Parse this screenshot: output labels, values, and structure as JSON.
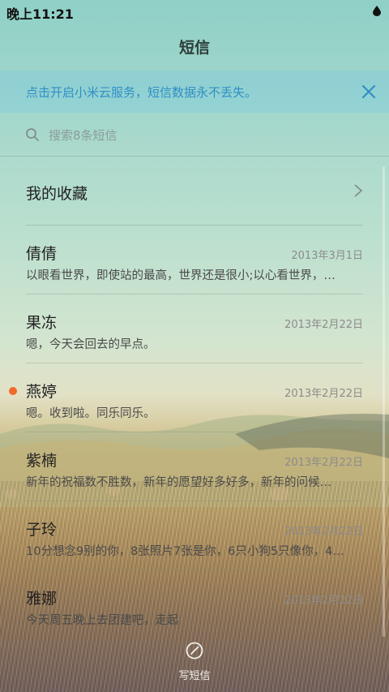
{
  "status_bar": {
    "time": "晚上11:21",
    "icon": "water-drop-icon"
  },
  "header": {
    "title": "短信"
  },
  "banner": {
    "text": "点击开启小米云服务，短信数据永不丢失。",
    "close_icon": "close-icon",
    "accent_color": "#2f8fc4"
  },
  "search": {
    "placeholder": "搜索8条短信",
    "icon": "search-icon"
  },
  "favorites": {
    "label": "我的收藏",
    "icon": "chevron-right-icon"
  },
  "conversations": [
    {
      "name": "倩倩",
      "date": "2013年3月1日",
      "preview": "以眼看世界，即使站的最高，世界还是很小;以心看世界，…",
      "unread": false
    },
    {
      "name": "果冻",
      "date": "2013年2月22日",
      "preview": "嗯，今天会回去的早点。",
      "unread": false
    },
    {
      "name": "燕婷",
      "date": "2013年2月22日",
      "preview": "嗯。收到啦。同乐同乐。",
      "unread": true
    },
    {
      "name": "紫楠",
      "date": "2013年2月22日",
      "preview": "新年的祝福数不胜数，新年的愿望好多好多，新年的问候…",
      "unread": false
    },
    {
      "name": "子玲",
      "date": "2013年2月22日",
      "preview": "10分想念9别的你，8张照片7张是你，6只小狗5只像你，4…",
      "unread": false
    },
    {
      "name": "雅娜",
      "date": "2013年2月22日",
      "preview": "今天周五晚上去团建吧，走起",
      "unread": false
    }
  ],
  "unread_color": "#f06a2c",
  "compose": {
    "label": "写短信",
    "icon": "compose-icon"
  }
}
